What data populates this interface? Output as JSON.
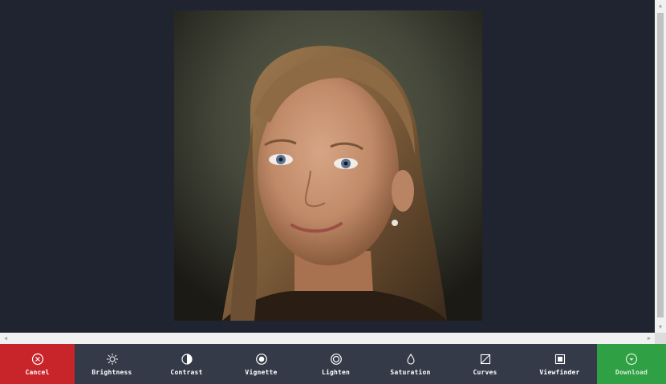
{
  "toolbar": {
    "cancel": {
      "label": "Cancel",
      "icon": "close-circle-icon",
      "color": "#c8252b"
    },
    "items": [
      {
        "label": "Brightness",
        "icon": "sun-icon"
      },
      {
        "label": "Contrast",
        "icon": "contrast-icon"
      },
      {
        "label": "Vignette",
        "icon": "vignette-icon"
      },
      {
        "label": "Lighten",
        "icon": "lighten-icon"
      },
      {
        "label": "Saturation",
        "icon": "droplet-icon"
      },
      {
        "label": "Curves",
        "icon": "curves-icon"
      },
      {
        "label": "Viewfinder",
        "icon": "viewfinder-icon"
      }
    ],
    "download": {
      "label": "Download",
      "icon": "download-circle-icon",
      "color": "#2fa043"
    }
  },
  "colors": {
    "background": "#1f2430",
    "toolbar": "#343a47"
  }
}
